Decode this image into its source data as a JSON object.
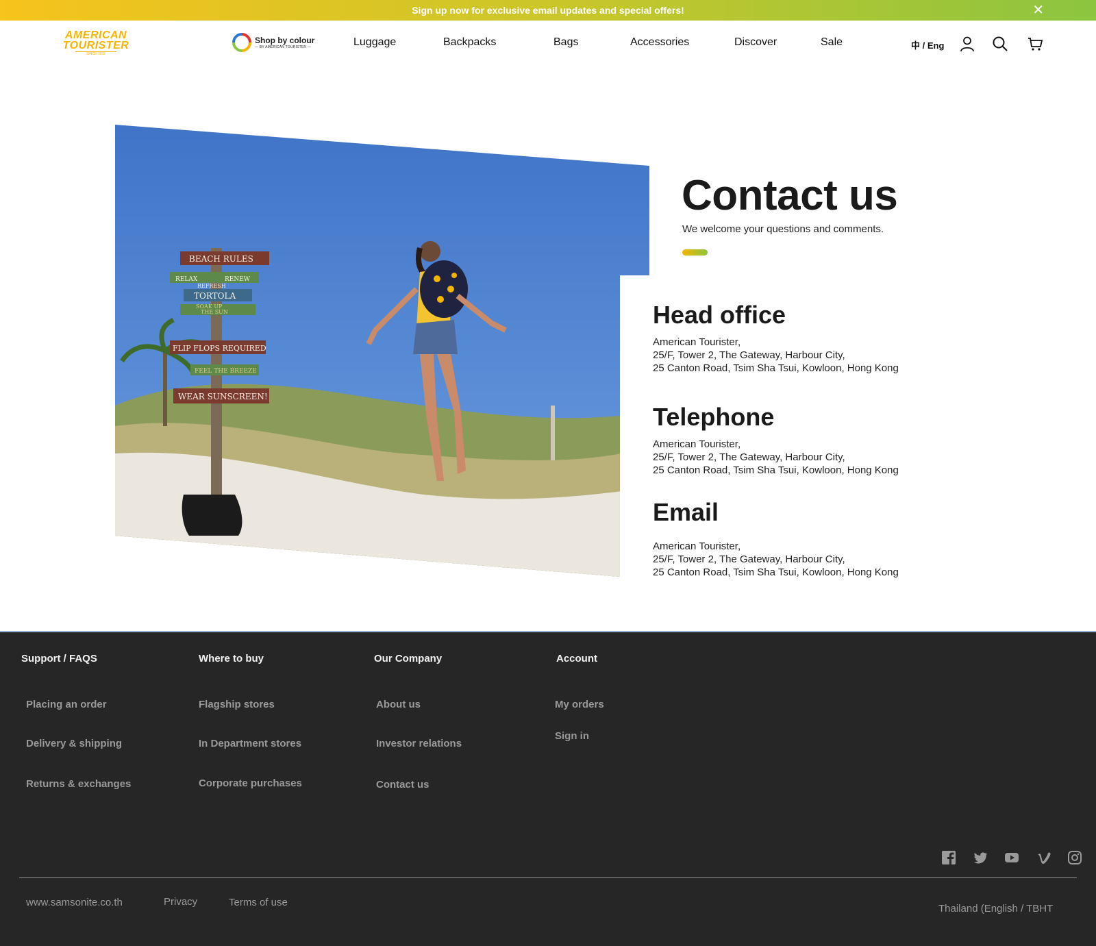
{
  "promo": {
    "text": "Sign up now for exclusive email updates and special offers!",
    "close": "✕"
  },
  "brand": {
    "line1": "AMERICAN",
    "line2": "TOURISTER",
    "since": "SINCE 1933"
  },
  "shop_by_colour": {
    "main": "Shop by colour",
    "sub": "— BY AMERICAN TOURISTER —"
  },
  "nav": [
    "Luggage",
    "Backpacks",
    "Bags",
    "Accessories",
    "Discover",
    "Sale"
  ],
  "lang": "中 / Eng",
  "hero": {
    "sign_lines": [
      "BEACH RULES",
      "RELAX",
      "RENEW",
      "REFRESH",
      "TORTOLA",
      "SOAK UP",
      "THE SUN",
      "FLIP FLOPS REQUIRED",
      "FEEL THE BREEZE",
      "WEAR SUNSCREEN!"
    ]
  },
  "page": {
    "title": "Contact us",
    "subtitle": "We welcome your questions and comments."
  },
  "sections": [
    {
      "title": "Head office",
      "lines": [
        "American Tourister,",
        "25/F, Tower 2, The Gateway, Harbour City,",
        "25 Canton Road, Tsim Sha Tsui, Kowloon, Hong Kong"
      ]
    },
    {
      "title": "Telephone",
      "lines": [
        "American Tourister,",
        "25/F, Tower 2, The Gateway, Harbour City,",
        "25 Canton Road, Tsim Sha Tsui, Kowloon, Hong Kong"
      ]
    },
    {
      "title": "Email",
      "lines": [
        "American Tourister,",
        "25/F, Tower 2, The Gateway, Harbour City,",
        "25 Canton Road, Tsim Sha Tsui, Kowloon, Hong Kong"
      ]
    }
  ],
  "footer": {
    "columns": [
      {
        "title": "Support / FAQS",
        "links": [
          "Placing an order",
          "Delivery & shipping",
          "Returns & exchanges"
        ]
      },
      {
        "title": "Where to buy",
        "links": [
          "Flagship stores",
          "In Department stores",
          "Corporate purchases"
        ]
      },
      {
        "title": "Our Company",
        "links": [
          "About us",
          "Investor relations",
          "Contact us"
        ]
      },
      {
        "title": "Account",
        "links": [
          "My orders",
          "Sign in"
        ]
      }
    ],
    "bottom": {
      "site": "www.samsonite.co.th",
      "privacy": "Privacy",
      "terms": "Terms of use",
      "region": "Thailand (English / TBHT"
    },
    "social": [
      "facebook-icon",
      "twitter-icon",
      "youtube-icon",
      "vimeo-icon",
      "instagram-icon"
    ]
  },
  "colors": {
    "brand_yellow": "#f4b400",
    "brand_green": "#8cc540",
    "footer_bg": "#262626"
  }
}
